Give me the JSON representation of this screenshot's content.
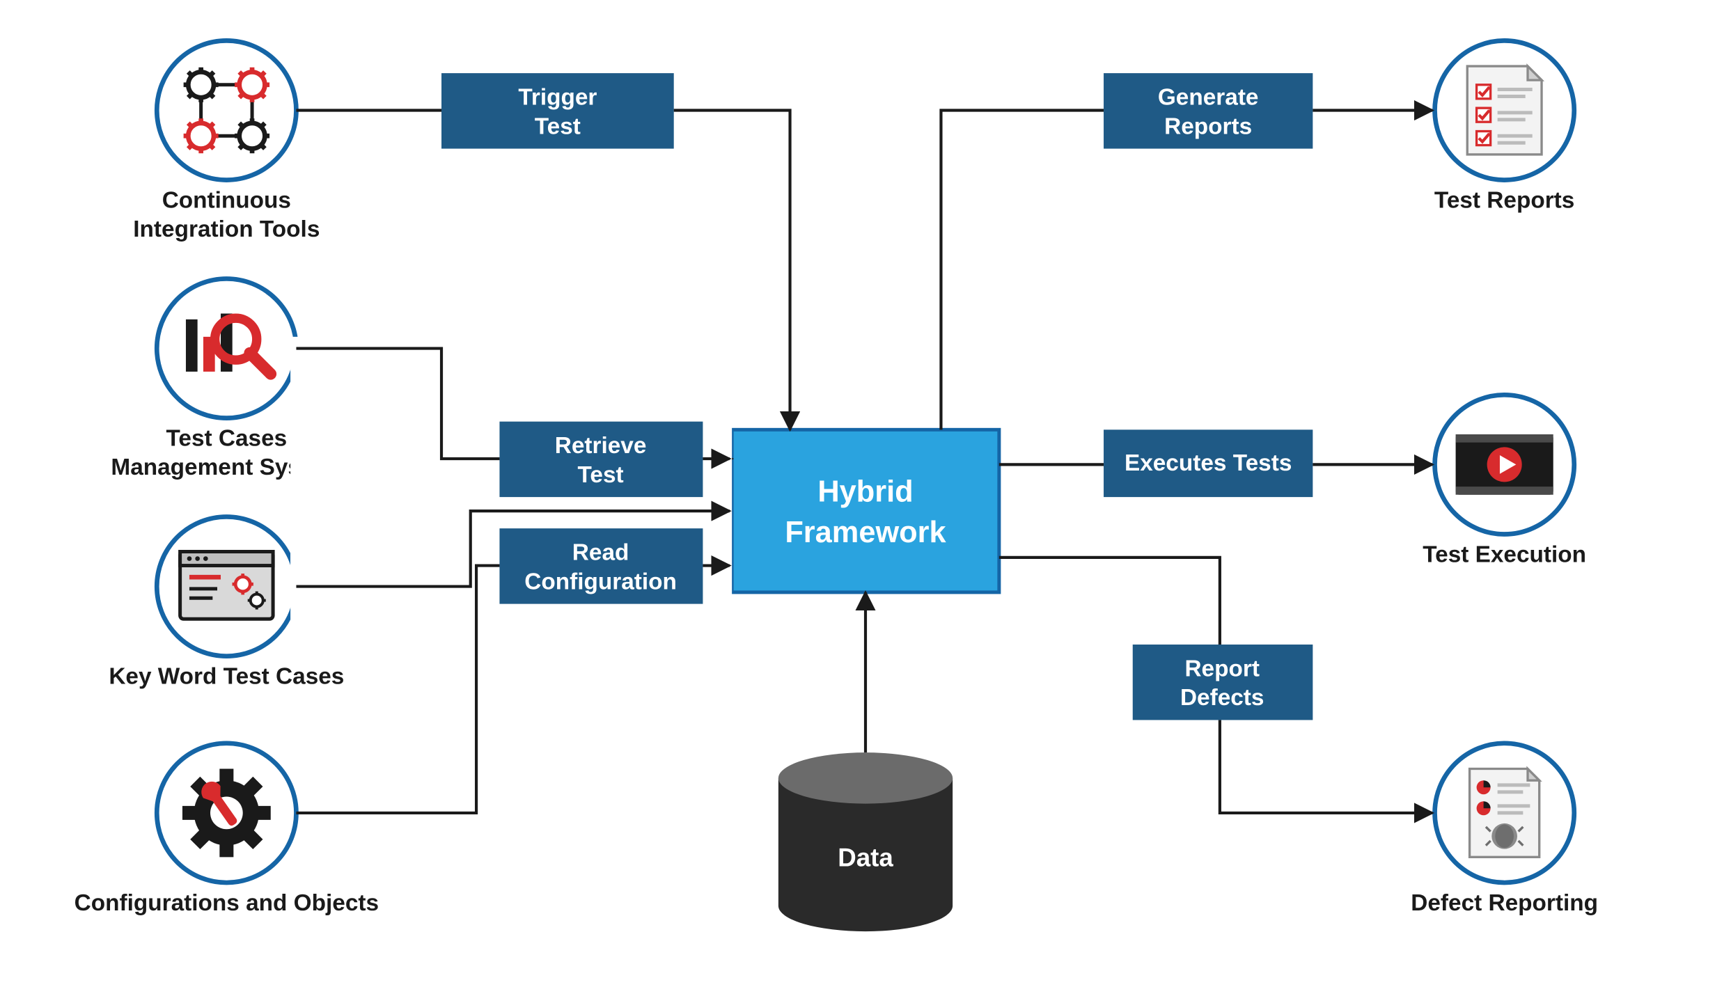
{
  "center": {
    "title_l1": "Hybrid",
    "title_l2": "Framework"
  },
  "data_node": {
    "label": "Data"
  },
  "left_nodes": [
    {
      "label_l1": "Continuous",
      "label_l2": "Integration Tools"
    },
    {
      "label_l1": "Test Cases",
      "label_l2": "Management System"
    },
    {
      "label_l1": "Key Word Test Cases",
      "label_l2": ""
    },
    {
      "label_l1": "Configurations and Objects",
      "label_l2": ""
    }
  ],
  "right_nodes": [
    {
      "label_l1": "Test Reports",
      "label_l2": ""
    },
    {
      "label_l1": "Test Execution",
      "label_l2": ""
    },
    {
      "label_l1": "Defect Reporting",
      "label_l2": ""
    }
  ],
  "left_boxes": [
    {
      "l1": "Trigger",
      "l2": "Test"
    },
    {
      "l1": "Retrieve",
      "l2": "Test"
    },
    {
      "l1": "Read",
      "l2": "Configuration"
    }
  ],
  "right_boxes": [
    {
      "l1": "Generate",
      "l2": "Reports"
    },
    {
      "l1": "Executes Tests",
      "l2": ""
    },
    {
      "l1": "Report",
      "l2": "Defects"
    }
  ],
  "colors": {
    "circle_stroke": "#1565A6",
    "box_fill": "#1F5A86",
    "center_fill": "#2AA3DF",
    "center_stroke": "#1565A6",
    "line": "#1a1a1a",
    "red": "#D82B2D",
    "gray": "#BEBEBE",
    "dark": "#2A2A2A"
  }
}
